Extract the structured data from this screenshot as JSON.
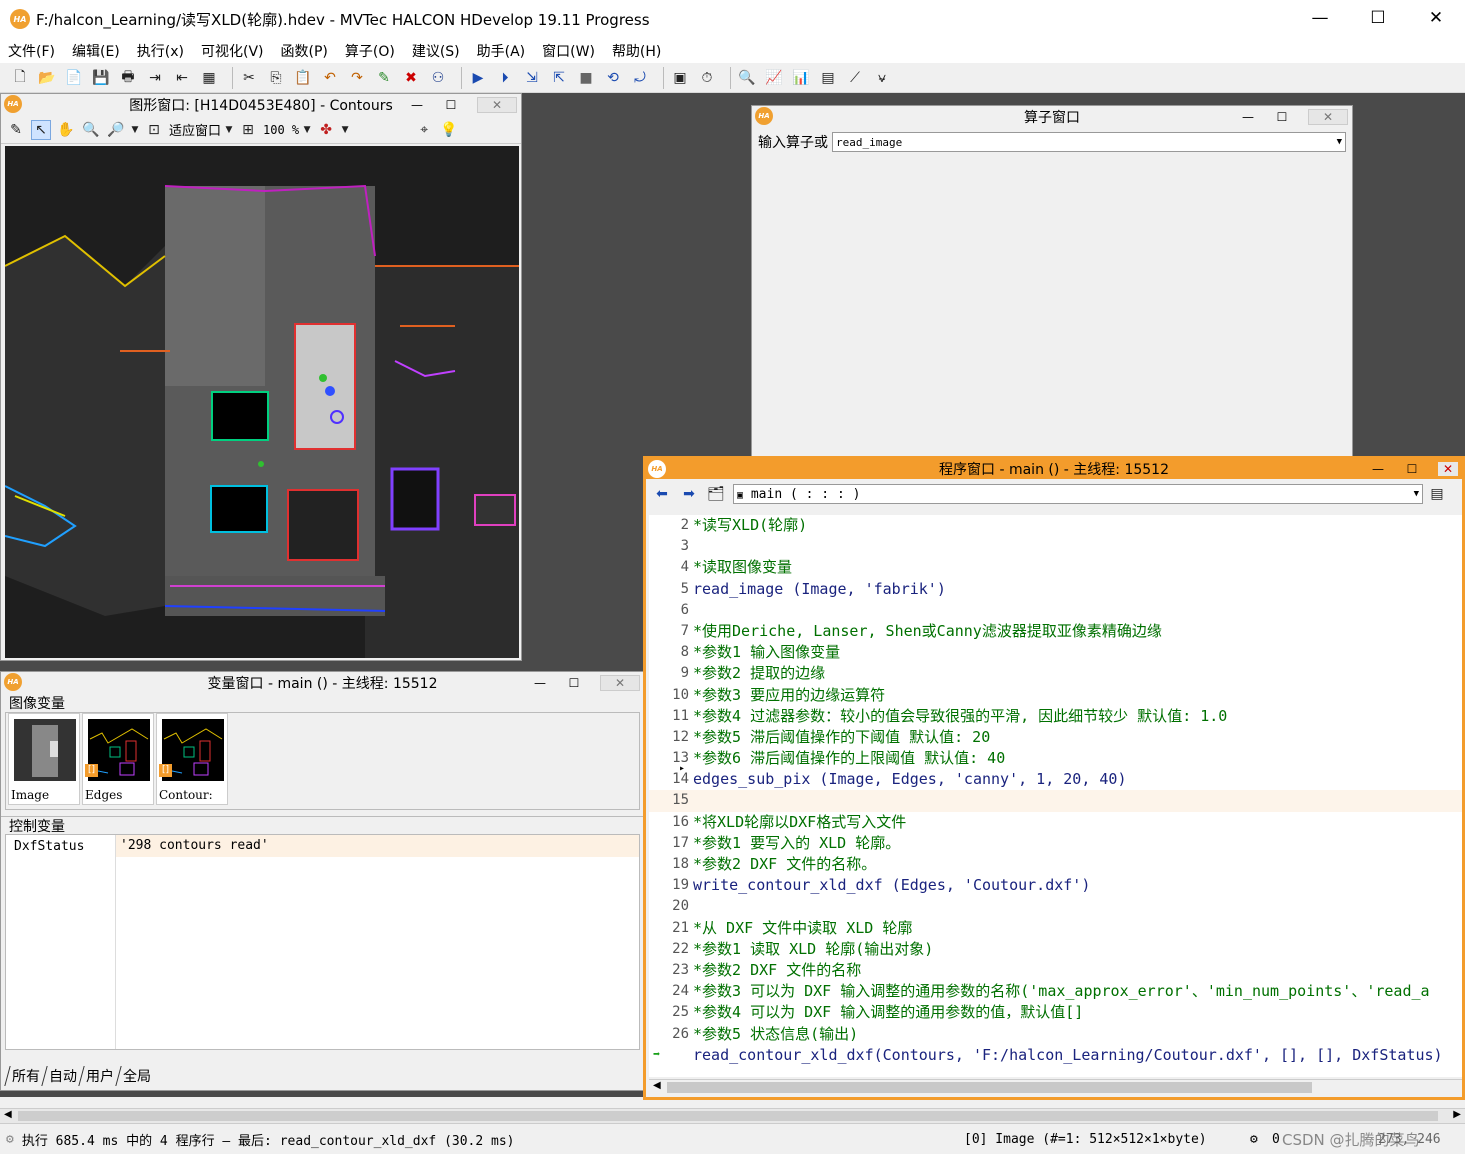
{
  "app": {
    "title": "F:/halcon_Learning/读写XLD(轮廓).hdev - MVTec HALCON HDevelop 19.11 Progress",
    "logo": "HA",
    "minimize": "—",
    "maximize": "☐",
    "close": "✕"
  },
  "menu": [
    "文件(F)",
    "编辑(E)",
    "执行(x)",
    "可视化(V)",
    "函数(P)",
    "算子(O)",
    "建议(S)",
    "助手(A)",
    "窗口(W)",
    "帮助(H)"
  ],
  "graphics_window": {
    "title": "图形窗口: [H14D0453E480] - Contours",
    "fit_label": "适应窗口",
    "zoom": "100 %"
  },
  "operator_window": {
    "title": "算子窗口",
    "input_label": "输入算子或",
    "input_value": "read_image"
  },
  "variable_window": {
    "title": "变量窗口 - main () - 主线程: 15512",
    "iconic_header": "图像变量",
    "iconic_vars": [
      "Image",
      "Edges",
      "Contour:"
    ],
    "control_header": "控制变量",
    "control_vars": [
      {
        "name": "DxfStatus",
        "value": "'298 contours read'"
      }
    ],
    "tabs": [
      "所有",
      "自动",
      "用户",
      "全局"
    ]
  },
  "program_window": {
    "title": "程序窗口 - main () - 主线程: 15512",
    "procedure": "main ( : : : )",
    "lines": [
      {
        "n": "2",
        "t": "*读写XLD(轮廓)",
        "k": "cm"
      },
      {
        "n": "3",
        "t": "",
        "k": "cm"
      },
      {
        "n": "4",
        "t": "*读取图像变量",
        "k": "cm"
      },
      {
        "n": "5",
        "t": "read_image (Image, 'fabrik')",
        "k": "kw"
      },
      {
        "n": "6",
        "t": "",
        "k": "cm"
      },
      {
        "n": "7",
        "t": "*使用Deriche, Lanser, Shen或Canny滤波器提取亚像素精确边缘",
        "k": "cm"
      },
      {
        "n": "8",
        "t": "*参数1 输入图像变量",
        "k": "cm"
      },
      {
        "n": "9",
        "t": "*参数2 提取的边缘",
        "k": "cm"
      },
      {
        "n": "10",
        "t": "*参数3 要应用的边缘运算符",
        "k": "cm"
      },
      {
        "n": "11",
        "t": "*参数4 过滤器参数：较小的值会导致很强的平滑, 因此细节较少 默认值: 1.0",
        "k": "cm"
      },
      {
        "n": "12",
        "t": "*参数5 滞后阈值操作的下阈值 默认值: 20",
        "k": "cm"
      },
      {
        "n": "13",
        "t": "*参数6 滞后阈值操作的上限阈值 默认值: 40",
        "k": "cm"
      },
      {
        "n": "14",
        "t": "edges_sub_pix (Image, Edges, 'canny', 1, 20, 40)",
        "k": "kw"
      },
      {
        "n": "15",
        "t": "",
        "k": "cm"
      },
      {
        "n": "16",
        "t": "*将XLD轮廓以DXF格式写入文件",
        "k": "cm"
      },
      {
        "n": "17",
        "t": "*参数1 要写入的 XLD 轮廓。",
        "k": "cm"
      },
      {
        "n": "18",
        "t": "*参数2 DXF 文件的名称。",
        "k": "cm"
      },
      {
        "n": "19",
        "t": "write_contour_xld_dxf (Edges, 'Coutour.dxf')",
        "k": "kw"
      },
      {
        "n": "20",
        "t": "",
        "k": "cm"
      },
      {
        "n": "21",
        "t": "*从 DXF 文件中读取 XLD 轮廓",
        "k": "cm"
      },
      {
        "n": "22",
        "t": "*参数1 读取 XLD 轮廓(输出对象)",
        "k": "cm"
      },
      {
        "n": "23",
        "t": "*参数2 DXF 文件的名称",
        "k": "cm"
      },
      {
        "n": "24",
        "t": "*参数3 可以为 DXF 输入调整的通用参数的名称('max_approx_error'、'min_num_points'、'read_a",
        "k": "cm"
      },
      {
        "n": "25",
        "t": "*参数4 可以为 DXF 输入调整的通用参数的值，默认值[]",
        "k": "cm"
      },
      {
        "n": "26",
        "t": "*参数5 状态信息(输出)",
        "k": "cm"
      },
      {
        "n": "",
        "t": "read_contour_xld_dxf(Contours, 'F:/halcon_Learning/Coutour.dxf', [], [], DxfStatus)",
        "k": "kw"
      }
    ]
  },
  "status": {
    "left": "执行 685.4 ms 中的 4 程序行 — 最后: read_contour_xld_dxf (30.2 ms)",
    "image_info": "[0] Image (#=1: 512×512×1×byte)",
    "coord": "0",
    "watermark": "CSDN @扎腾的菜鸟",
    "pos": "273, 246"
  },
  "colors": {
    "accent": "#f39c2c",
    "workspace": "#4a4a4a"
  }
}
